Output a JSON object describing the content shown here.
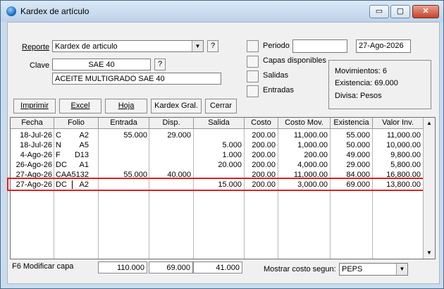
{
  "window": {
    "title": "Kardex de artículo",
    "min": "▭",
    "max": "▢",
    "close": "✕"
  },
  "form": {
    "reporte_label": "Reporte",
    "reporte_value": "Kardex de articulo",
    "help": "?",
    "clave_label": "Clave",
    "clave_value": "SAE 40",
    "descripcion": "ACEITE MULTIGRADO SAE 40",
    "periodo_label": "Periodo",
    "periodo_from": "",
    "periodo_to": "27-Ago-2026",
    "capas_label": "Capas disponibles",
    "salidas_label": "Salidas",
    "entradas_label": "Entradas"
  },
  "info": {
    "movimientos": "Movimientos:   6",
    "existencia": "Existencia: 69.000",
    "divisa": "Divisa: Pesos"
  },
  "buttons": {
    "imprimir": "Imprimir",
    "excel": "Excel",
    "hoja": "Hoja",
    "kardex_gral": "Kardex Gral.",
    "cerrar": "Cerrar"
  },
  "table": {
    "columns": [
      "Fecha",
      "Folio",
      "Entrada",
      "Disp.",
      "Salida",
      "Costo",
      "Costo Mov.",
      "Existencia",
      "Valor Inv."
    ],
    "rows": [
      {
        "fecha": "18-Jul-26",
        "tipo": "C",
        "folio": "A2",
        "entrada": "55.000",
        "disp": "29.000",
        "salida": "",
        "costo": "200.00",
        "costo_mov": "11,000.00",
        "existencia": "55.000",
        "valor": "11,000.00"
      },
      {
        "fecha": "18-Jul-26",
        "tipo": "N",
        "folio": "A5",
        "entrada": "",
        "disp": "",
        "salida": "5.000",
        "costo": "200.00",
        "costo_mov": "1,000.00",
        "existencia": "50.000",
        "valor": "10,000.00"
      },
      {
        "fecha": "4-Ago-26",
        "tipo": "F",
        "folio": "D13",
        "entrada": "",
        "disp": "",
        "salida": "1.000",
        "costo": "200.00",
        "costo_mov": "200.00",
        "existencia": "49.000",
        "valor": "9,800.00"
      },
      {
        "fecha": "26-Ago-26",
        "tipo": "DC",
        "folio": "A1",
        "entrada": "",
        "disp": "",
        "salida": "20.000",
        "costo": "200.00",
        "costo_mov": "4,000.00",
        "existencia": "29.000",
        "valor": "5,800.00"
      },
      {
        "fecha": "27-Ago-26",
        "tipo": "C",
        "folio": "AA5132",
        "entrada": "55.000",
        "disp": "40.000",
        "salida": "",
        "costo": "200.00",
        "costo_mov": "11,000.00",
        "existencia": "84.000",
        "valor": "16,800.00"
      },
      {
        "fecha": "27-Ago-26",
        "tipo": "DC",
        "folio": "A2",
        "entrada": "",
        "disp": "",
        "salida": "15.000",
        "costo": "200.00",
        "costo_mov": "3,000.00",
        "existencia": "69.000",
        "valor": "13,800.00"
      }
    ]
  },
  "footer": {
    "f6": "F6 Modificar capa",
    "total_entrada": "110.000",
    "total_disp": "69.000",
    "total_salida": "41.000",
    "mostrar_label": "Mostrar costo segun:",
    "mostrar_value": "PEPS"
  },
  "icons": {
    "scroll_up": "up-arrow-icon",
    "scroll_down": "down-arrow-icon",
    "dropdown": "chevron-down-icon"
  }
}
